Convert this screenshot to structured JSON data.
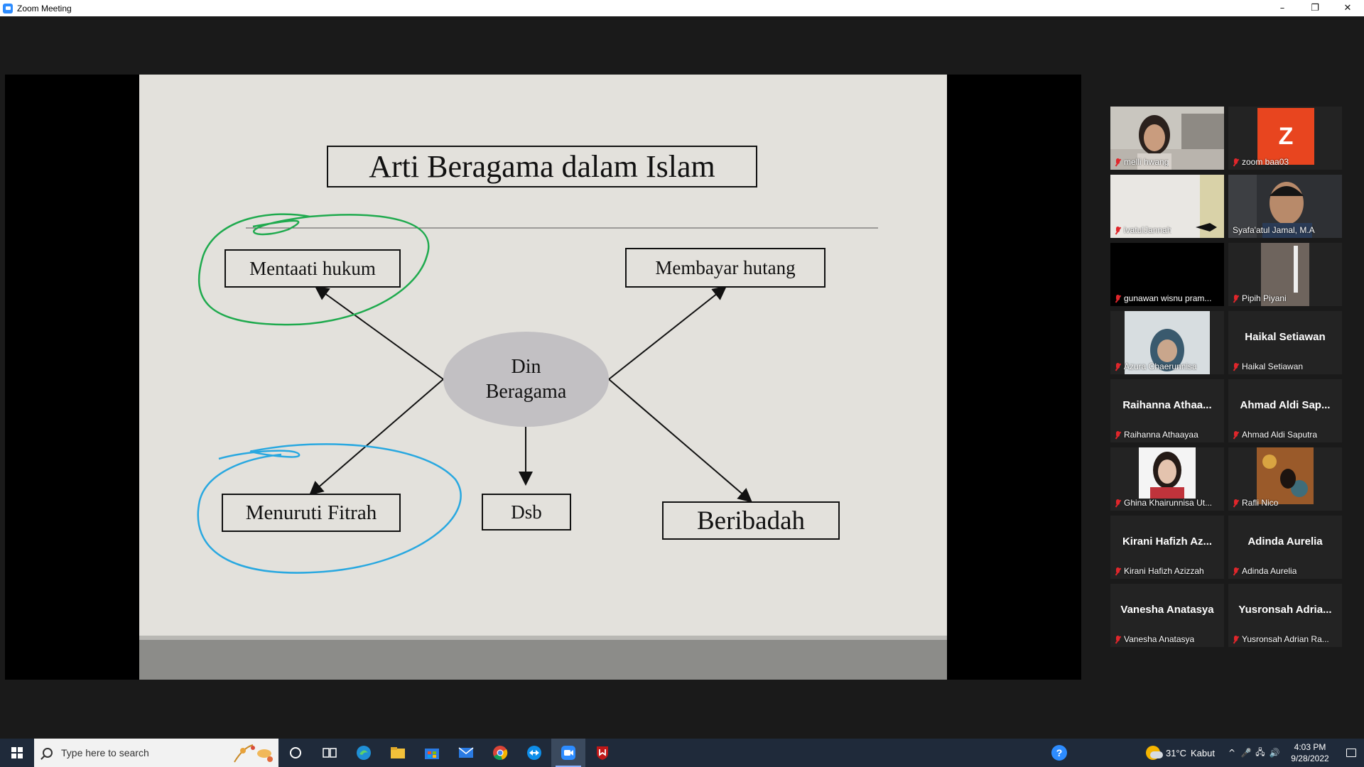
{
  "window": {
    "title": "Zoom Meeting",
    "minimize": "–",
    "restore": "❐",
    "close": "✕",
    "accent": "#2d8cff"
  },
  "slide": {
    "title": "Arti Beragama dalam Islam",
    "center_line1": "Din",
    "center_line2": "Beragama",
    "items": {
      "mentaati": "Mentaati hukum",
      "membayar": "Membayar hutang",
      "menuruti": "Menuruti Fitrah",
      "dsb": "Dsb",
      "beribadah": "Beribadah"
    },
    "annotation_colors": {
      "green": "#1faa4e",
      "blue": "#29a8e0"
    }
  },
  "gallery": {
    "participants": [
      {
        "name": "melli hwang",
        "has_video": true
      },
      {
        "name": "zoom baa03",
        "avatar_letter": "Z",
        "avatar_color": "#e8451f"
      },
      {
        "name": "ivatulJannah",
        "has_video": true
      },
      {
        "name": "Syafa'atul Jamal, M.A",
        "has_video": true,
        "active_speaker": true
      },
      {
        "name": "gunawan wisnu pram...",
        "has_video": true
      },
      {
        "name": "Pipih Piyani",
        "has_video": true
      },
      {
        "name": "Azura Chaerunnisa",
        "has_video": true
      },
      {
        "name": "Haikal Setiawan",
        "display_name": "Haikal Setiawan"
      },
      {
        "name": "Raihanna Athaayaa",
        "display_name": "Raihanna Athaa..."
      },
      {
        "name": "Ahmad Aldi Saputra",
        "display_name": "Ahmad Aldi Sap..."
      },
      {
        "name": "Ghina Khairunnisa Ut...",
        "has_video": true
      },
      {
        "name": "Rafli Nico",
        "has_video": true
      },
      {
        "name": "Kirani Hafizh Azizzah",
        "display_name": "Kirani Hafizh Az..."
      },
      {
        "name": "Adinda Aurelia",
        "display_name": "Adinda Aurelia"
      },
      {
        "name": "Vanesha Anatasya",
        "display_name": "Vanesha Anatasya"
      },
      {
        "name": "Yusronsah Adrian Ra...",
        "display_name": "Yusronsah Adria..."
      }
    ],
    "muted_color": "#e0262b",
    "active_border_color": "#c9e64a"
  },
  "taskbar": {
    "search_placeholder": "Type here to search",
    "icons": [
      "cortana-icon",
      "task-view-icon",
      "edge-icon",
      "file-explorer-icon",
      "store-icon",
      "mail-icon",
      "chrome-icon",
      "teamviewer-icon",
      "zoom-icon",
      "mcafee-icon"
    ],
    "weather_temp": "31°C",
    "weather_desc": "Kabut",
    "time": "4:03 PM",
    "date": "9/28/2022",
    "help_glyph": "?",
    "tray_up": "^",
    "tray_mic": "🎤",
    "tray_net": "🖧",
    "tray_vol": "🔊"
  }
}
